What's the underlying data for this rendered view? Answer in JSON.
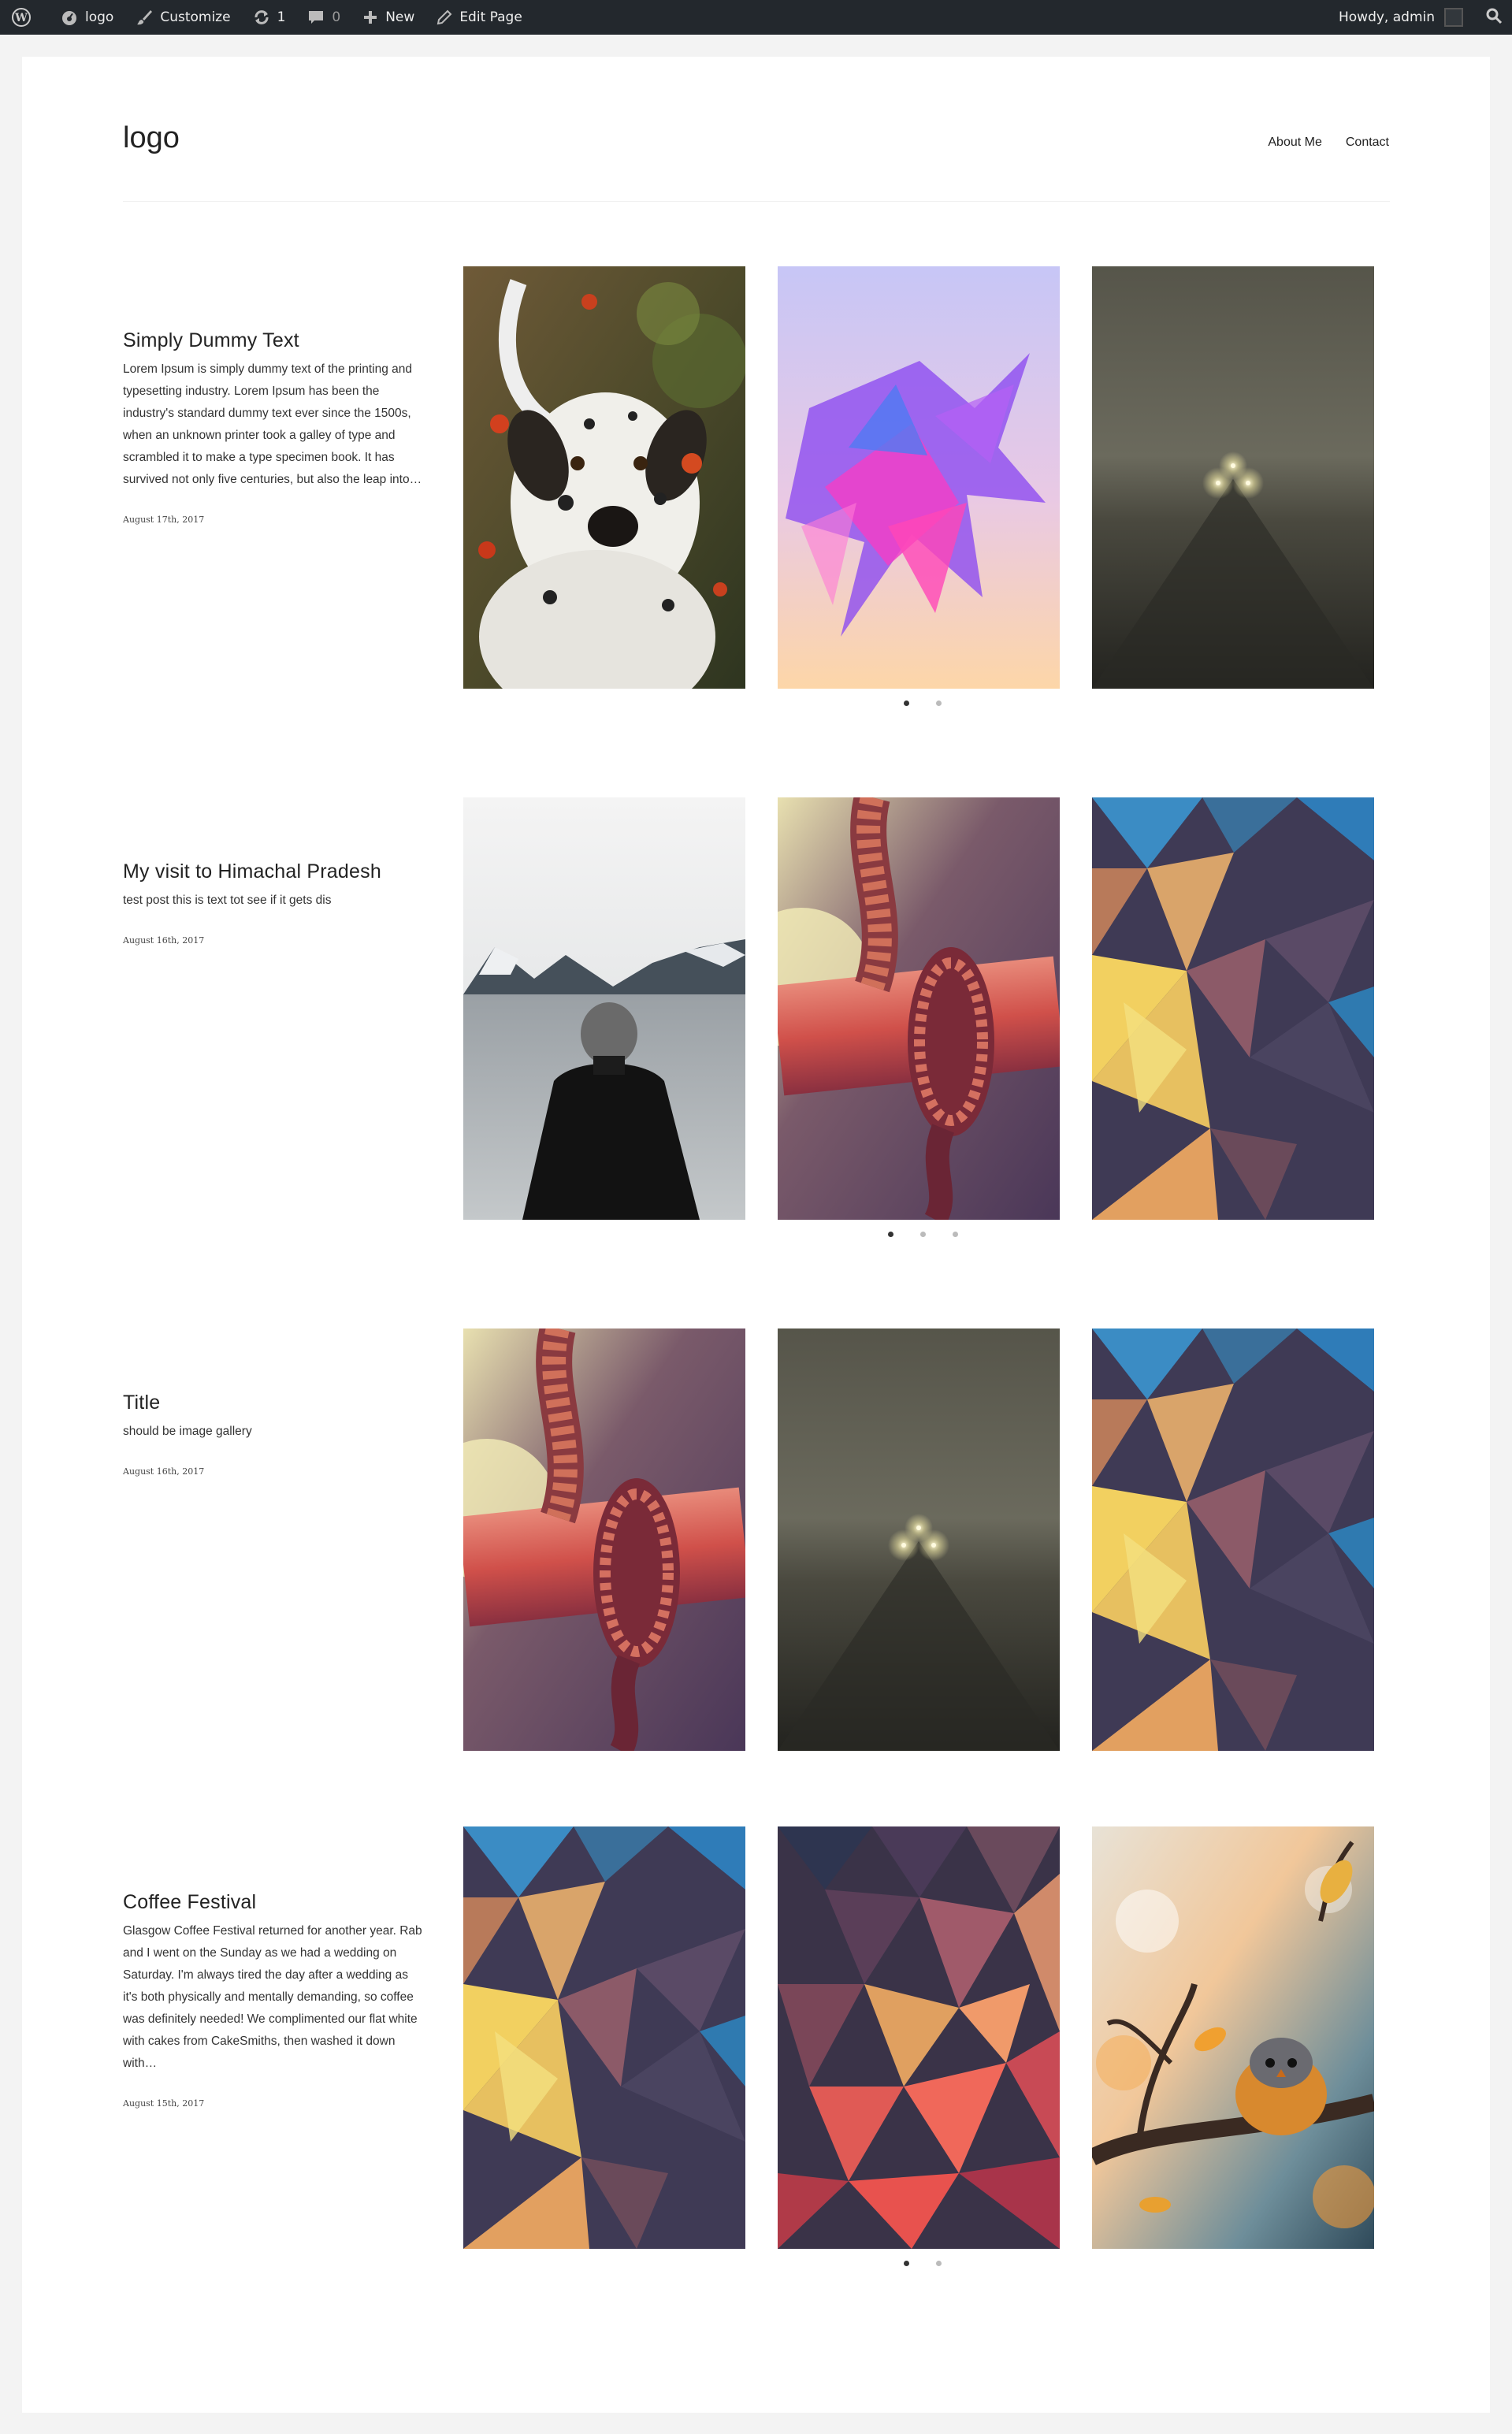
{
  "adminbar": {
    "site": "logo",
    "customize": "Customize",
    "updates": "1",
    "comments": "0",
    "new": "New",
    "edit": "Edit Page",
    "howdy": "Howdy, admin"
  },
  "header": {
    "logo": "logo",
    "nav": [
      "About Me",
      "Contact"
    ]
  },
  "posts": [
    {
      "title": "Simply Dummy Text",
      "excerpt": "Lorem Ipsum is simply dummy text of the printing and typesetting industry. Lorem Ipsum has been the industry's standard dummy text ever since the 1500s, when an unknown printer took a galley of type and scrambled it to make a type specimen book. It has survived not only five centuries, but also the leap into…",
      "date": "August 17th, 2017",
      "images": [
        "dalmatian-dog-photo",
        "abstract-crystal-photo",
        "foggy-road-lights-photo"
      ],
      "dots": 2
    },
    {
      "title": "My visit to Himachal Pradesh",
      "excerpt": "test post this is text tot see if it gets dis",
      "date": "August 16th, 2017",
      "images": [
        "man-at-lake-photo",
        "rope-knot-photo",
        "polygon-pattern-photo"
      ],
      "dots": 3
    },
    {
      "title": "Title",
      "excerpt": "should be image gallery",
      "date": "August 16th, 2017",
      "images": [
        "rope-knot-photo",
        "foggy-road-lights-photo",
        "polygon-pattern-photo"
      ],
      "dots": 0
    },
    {
      "title": "Coffee Festival",
      "excerpt": "Glasgow Coffee Festival returned for another year. Rab and I went on the Sunday as we had a wedding on Saturday. I'm always tired the day after a wedding as it's both physically and mentally demanding, so coffee was definitely needed! We complimented our flat white with cakes from CakeSmiths, then washed it down with…",
      "date": "August 15th, 2017",
      "images": [
        "polygon-pattern-photo",
        "red-polygon-pattern-photo",
        "bird-on-branch-photo"
      ],
      "dots": 2
    }
  ]
}
